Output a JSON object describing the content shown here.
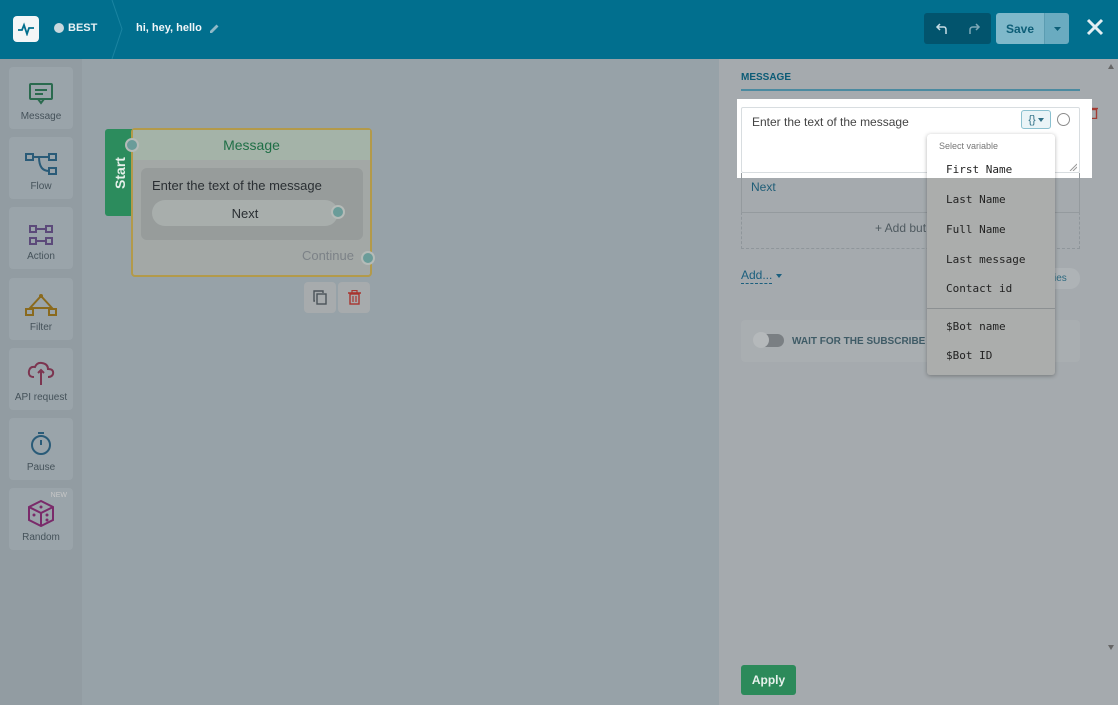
{
  "header": {
    "bot_name": "BEST",
    "flow_title": "hi, hey, hello",
    "save_label": "Save"
  },
  "sidebar": {
    "tools": [
      {
        "label": "Message",
        "icon": "message-icon"
      },
      {
        "label": "Flow",
        "icon": "flow-icon"
      },
      {
        "label": "Action",
        "icon": "action-icon"
      },
      {
        "label": "Filter",
        "icon": "filter-icon"
      },
      {
        "label": "API request",
        "icon": "api-request-icon"
      },
      {
        "label": "Pause",
        "icon": "pause-icon"
      },
      {
        "label": "Random",
        "icon": "random-icon",
        "badge": "NEW"
      }
    ]
  },
  "node": {
    "start_label": "Start",
    "title": "Message",
    "text": "Enter the text of the message",
    "button": "Next",
    "continue_label": "Continue"
  },
  "panel": {
    "title": "MESSAGE",
    "message_placeholder": "Enter the text of the message",
    "button_label": "Next",
    "add_button_label": "+ Add but",
    "add_label": "Add...",
    "tag_label": "ies",
    "wait_label": "WAIT FOR THE SUBSCRIBE",
    "apply_label": "Apply"
  },
  "variables_dropdown": {
    "header": "Select variable",
    "group1": [
      "First Name",
      "Last Name",
      "Full Name",
      "Last message",
      "Contact id"
    ],
    "group2": [
      "$Bot name",
      "$Bot ID"
    ]
  },
  "colors": {
    "topbar": "#016f8e",
    "accent_green": "#2c8a5a",
    "overlay_gray": "#97a2a8"
  }
}
